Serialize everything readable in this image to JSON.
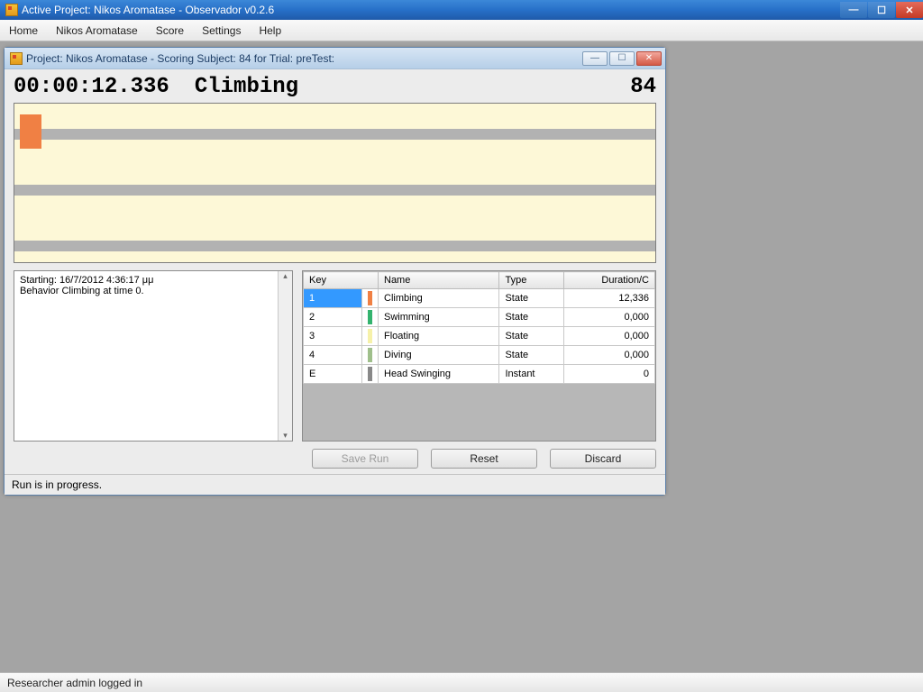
{
  "app": {
    "title": "Active Project: Nikos Aromatase - Observador v0.2.6"
  },
  "menu": {
    "home": "Home",
    "project": "Nikos Aromatase",
    "score": "Score",
    "settings": "Settings",
    "help": "Help"
  },
  "child": {
    "title": "Project: Nikos Aromatase - Scoring Subject: 84 for Trial: preTest:"
  },
  "score": {
    "timer": "00:00:12.336",
    "behavior": "Climbing",
    "subject": "84"
  },
  "log": {
    "line1": "Starting: 16/7/2012 4:36:17 μμ",
    "line2": "Behavior Climbing at time 0."
  },
  "grid": {
    "headers": {
      "key": "Key",
      "name": "Name",
      "type": "Type",
      "dur": "Duration/C"
    },
    "rows": [
      {
        "key": "1",
        "color": "#f08044",
        "name": "Climbing",
        "type": "State",
        "dur": "12,336",
        "selected": true
      },
      {
        "key": "2",
        "color": "#33b36e",
        "name": "Swimming",
        "type": "State",
        "dur": "0,000"
      },
      {
        "key": "3",
        "color": "#f6f1a9",
        "name": "Floating",
        "type": "State",
        "dur": "0,000"
      },
      {
        "key": "4",
        "color": "#9fbf8b",
        "name": "Diving",
        "type": "State",
        "dur": "0,000"
      },
      {
        "key": "E",
        "color": "#888888",
        "name": "Head Swinging",
        "type": "Instant",
        "dur": "0"
      }
    ]
  },
  "buttons": {
    "save": "Save Run",
    "reset": "Reset",
    "discard": "Discard"
  },
  "child_status": "Run is in progress.",
  "statusbar": "Researcher admin logged in"
}
